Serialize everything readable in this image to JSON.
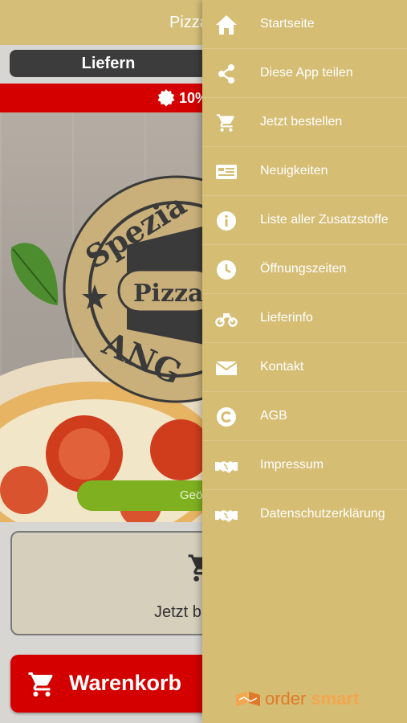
{
  "colors": {
    "header": "#d5bf78",
    "drawer": "#d6bd74",
    "promo_red": "#d40000",
    "status_green": "#7fb020",
    "logo_orange": "#e07a2a"
  },
  "app": {
    "title": "Pizza",
    "segment_label": "Liefern",
    "promo_text": "10%",
    "badge": {
      "line1": "Spezia",
      "center": "Pizza",
      "bottom": "ANG"
    },
    "status_text": "Geö",
    "order_label": "Jetzt b",
    "cart_label": "Warenkorb"
  },
  "drawer": {
    "items": [
      {
        "label": "Startseite",
        "icon": "home-icon"
      },
      {
        "label": "Diese App teilen",
        "icon": "share-icon"
      },
      {
        "label": "Jetzt bestellen",
        "icon": "cart-icon"
      },
      {
        "label": "Neuigkeiten",
        "icon": "news-icon"
      },
      {
        "label": "Liste aller Zusatzstoffe",
        "icon": "info-icon"
      },
      {
        "label": "Öffnungszeiten",
        "icon": "clock-icon"
      },
      {
        "label": "Lieferinfo",
        "icon": "motorbike-icon"
      },
      {
        "label": "Kontakt",
        "icon": "envelope-icon"
      },
      {
        "label": "AGB",
        "icon": "copyright-icon"
      },
      {
        "label": "Impressum",
        "icon": "handshake-icon"
      },
      {
        "label": "Datenschutzerklärung",
        "icon": "handshake-icon"
      }
    ],
    "logo": {
      "part1": "order",
      "part2": "smart"
    }
  }
}
